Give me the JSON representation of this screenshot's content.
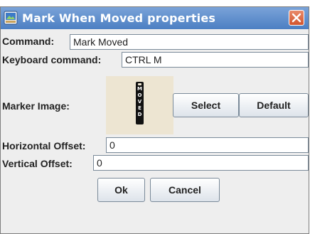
{
  "window": {
    "title": "Mark When Moved properties"
  },
  "form": {
    "command_label": "Command:",
    "command_value": "Mark Moved",
    "keyboard_label": "Keyboard command:",
    "keyboard_value": "CTRL M",
    "marker_label": "Marker Image:",
    "marker_text": [
      "M",
      "O",
      "V",
      "E",
      "D"
    ],
    "select_label": "Select",
    "default_label": "Default",
    "hoffset_label": "Horizontal Offset:",
    "hoffset_value": "0",
    "voffset_label": "Vertical Offset:",
    "voffset_value": "0"
  },
  "actions": {
    "ok_label": "Ok",
    "cancel_label": "Cancel"
  },
  "icons": {
    "title": "app-icon",
    "close": "close-icon"
  }
}
